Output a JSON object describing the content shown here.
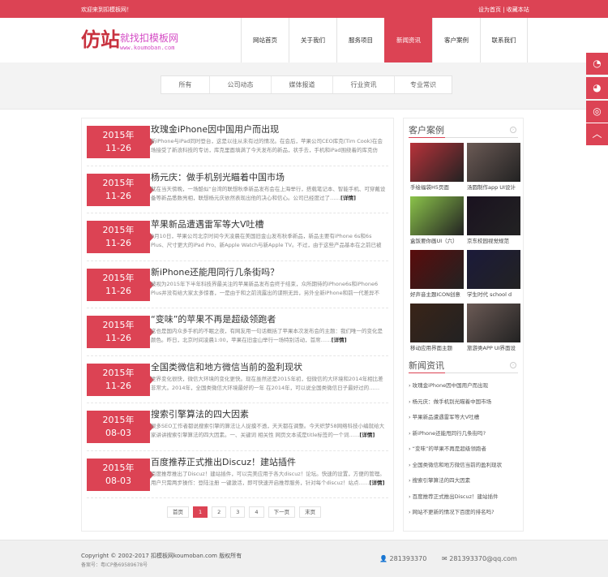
{
  "topbar": {
    "welcome": "欢迎来到扣模板网！",
    "links": "设为首页 | 收藏本站"
  },
  "logo": {
    "big": "仿站",
    "slogan": "就找扣模板网",
    "url": "www.koumoban.com"
  },
  "nav": [
    "网站首页",
    "关于我们",
    "服务项目",
    "新闻资讯",
    "客户案例",
    "联系我们"
  ],
  "nav_active": 3,
  "filters": [
    "所有",
    "公司动态",
    "媒体报道",
    "行业资讯",
    "专业常识"
  ],
  "articles": [
    {
      "year": "2015年",
      "md": "11-26",
      "title": "玫瑰金iPhone因中国用户而出现",
      "desc": "新iPhone与iPad同时登台，这是以往从未有过的情况。在会后，苹果公司CEO库克(Tim Cook)在会场接受了新浪科技的专访，库克里面填满了今天发布的新品，状手去，手机和iPad围绕着的库克仿佛……",
      "more": ""
    },
    {
      "year": "2015年",
      "md": "11-26",
      "title": "杨元庆：做手机别光瞄着中国市场",
      "desc": "就在当天傍晚，一场酷似“台湾的联想秋季新品发布会在上海举行，搭载笔记本、智能手机、可穿戴设备等新品悉数亮相，联想杨元庆依然表现出他的决心和信心。公司已经度过了……",
      "more": "[详情]"
    },
    {
      "year": "2015年",
      "md": "11-26",
      "title": "苹果新品遭遇雷军等大V吐槽",
      "desc": "9月10日，苹果公司北京时间今天凌晨在美国旧金山发布秋季新品，新品主要有iPhone 6s和6s Plus、尺寸更大的iPad Pro、新Apple Watch与新Apple TV。不过，由于这些产品基本在之前已被曝光……",
      "more": ""
    },
    {
      "year": "2015年",
      "md": "11-26",
      "title": "新iPhone还能甩同行几条街吗？",
      "desc": "被视为2015年下半年科技界最关注的苹果新品发布会终于结束，众所期待的iPhone6s和iPhone6 Plus并没有给大家太多惊喜，一是由于和之前流露出的谍照无异，另外全新iPhone和前一代差异不大……",
      "more": ""
    },
    {
      "year": "2015年",
      "md": "11-26",
      "title": "“变味”的苹果不再是超级领跑者",
      "desc": "这也是国内众多手机的不眠之夜，有网友用一句话概括了苹果本次发布会的主题：我们唯一的变化是颜色。昨日，北京时间凌晨1:00，苹果在旧金山举行一场特别活动，首席……",
      "more": "[详情]"
    },
    {
      "year": "2015年",
      "md": "11-26",
      "title": "全国类微信和地方微信当前的盈利现状",
      "desc": "世界变化很快，微信大环境的变化更快。现在虽然还是2015年初，但微信的大环境和2014年相比差非常大。2014年，全国类微信大环境最好的一年 在2014年，可以说全国类微信日子最好过的……",
      "more": "[详情]"
    },
    {
      "year": "2015年",
      "md": "08-03",
      "title": "搜索引擎算法的四大因素",
      "desc": "很多SEO工作者都说搜索引擎的算法让人捉摸不透，天天都在调整。今天织梦58网络科技小编就给大家讲讲搜索引擎算法的四大因素。一、关键词 相关性 网页文本或是title标签的一个词……",
      "more": "[详情]"
    },
    {
      "year": "2015年",
      "md": "08-03",
      "title": "百度推荐正式推出Discuz！建站插件",
      "desc": "百度推荐推出了Discuz！建站插件，可以完美应用于各大discuz！论坛。快速的设置，方便的管理。用户只需两步操作：登陆注册 一键激活，即可快速开启推荐服务，针对每个discuz！站点……",
      "more": "[详情]"
    }
  ],
  "pager": [
    "首页",
    "1",
    "2",
    "3",
    "4",
    "下一页",
    "末页"
  ],
  "pager_active": 1,
  "cases": {
    "title": "客户案例",
    "more": "›",
    "items": [
      {
        "caption": "手绘福袋H5页面",
        "color": "#b8323a"
      },
      {
        "caption": "汤圆制作app UI设计",
        "color": "#6b5a55"
      },
      {
        "caption": "盒饭要你画UI（六）",
        "color": "#8bc34a"
      },
      {
        "caption": "京东校园视觉规范",
        "color": "#1a1220"
      },
      {
        "caption": "好声音主题ICON创意",
        "color": "#5a0c0c"
      },
      {
        "caption": "学生时代 school d",
        "color": "#1b1a3a"
      },
      {
        "caption": "移动应用界面主题",
        "color": "#3a2418"
      },
      {
        "caption": "旅游类APP UI界面设",
        "color": "#6b5a55"
      }
    ]
  },
  "news": {
    "title": "新闻资讯",
    "more": "›",
    "items": [
      "玫瑰金iPhone因中国用户而出现",
      "杨元庆：做手机别光瞄着中国市场",
      "苹果新品遭遇雷军等大V吐槽",
      "新iPhone还能甩同行几条街吗?",
      "“变味”的苹果不再是超级领跑者",
      "全国类微信和地方微信当前的盈利现状",
      "搜索引擎算法的四大因素",
      "百度推荐正式推出Discuz！建站插件",
      "网站不更新的情况下百度的排名吗?"
    ]
  },
  "footer": {
    "copyright": "Copyright © 2002-2017 扣模板网koumoban.com 版权所有",
    "icp": "备案号：粤ICP备69589678号",
    "qq": "281393370",
    "email": "281393370@qq.com"
  },
  "floats": [
    {
      "icon": "qq-icon",
      "glyph": "◔"
    },
    {
      "icon": "wechat-icon",
      "glyph": "◕"
    },
    {
      "icon": "weibo-icon",
      "glyph": "◎"
    },
    {
      "icon": "back-to-top-icon",
      "glyph": "︿"
    }
  ],
  "colors": {
    "brand": "#dc4354"
  }
}
